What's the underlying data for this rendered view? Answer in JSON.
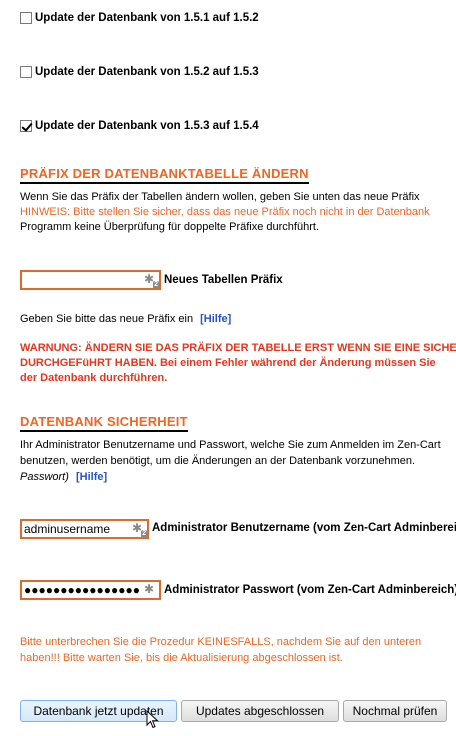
{
  "updates": [
    {
      "label": "Update der Datenbank von 1.5.1 auf 1.5.2",
      "checked": false
    },
    {
      "label": "Update der Datenbank von 1.5.2 auf 1.5.3",
      "checked": false
    },
    {
      "label": "Update der Datenbank von 1.5.3 auf 1.5.4",
      "checked": true
    }
  ],
  "prefix_section": {
    "heading": "PRÄFIX DER DATENBANKTABELLE ÄNDERN",
    "intro_line1": "Wenn Sie das Präfix der Tabellen ändern wollen, geben Sie unten das neue Präfix",
    "hint_line": "HINWEIS: Bitte stellen Sie sicher, dass das neue Präfix noch nicht in der Datenbank",
    "intro_line3": "Programm keine Überprüfung für doppelte Präfixe durchführt.",
    "input_value": "",
    "input_label": "Neues Tabellen Präfix",
    "instruction": "Geben Sie bitte das neue Präfix ein",
    "help_link": "[Hilfe]",
    "warning_line1": "WARNUNG: ÄNDERN SIE DAS PRÄFIX DER TABELLE ERST WENN SIE EINE SICHERUNG",
    "warning_line2": "DURCHGEFüHRT HABEN. Bei einem Fehler während der Änderung müssen Sie",
    "warning_line3": "der Datenbank durchführen."
  },
  "backup_section": {
    "heading": "DATENBANK SICHERHEIT",
    "line1": "Ihr Administrator Benutzername und Passwort, welche Sie zum Anmelden im Zen-Cart",
    "line2": "benutzen, werden benötigt, um die Änderungen an der Datenbank vorzunehmen.",
    "line3_italic": "Passwort)",
    "help_link": "[Hilfe]",
    "username_value": "adminusername",
    "username_label": "Administrator Benutzername (vom Zen-Cart Adminbereich)",
    "password_value": "●●●●●●●●●●●●●●●●",
    "password_label": "Administrator Passwort (vom Zen-Cart Adminbereich)"
  },
  "notice": {
    "line1": " Bitte unterbrechen Sie die Prozedur KEINESFALLS, nachdem Sie auf den unteren",
    "line2": "haben!!! Bitte warten Sie, bis die Aktualisierung abgeschlossen ist."
  },
  "buttons": {
    "update_now": "Datenbank jetzt updaten",
    "updates_done": "Updates abgeschlossen",
    "check_again": "Nochmal prüfen"
  },
  "icons": {
    "field_icon": "password-manager-key-icon",
    "cursor": "mouse-pointer-icon"
  },
  "colors": {
    "accent_orange": "#f26522",
    "warning_red": "#e8361d",
    "link_blue": "#2255cc",
    "input_border": "#e06a2c"
  }
}
